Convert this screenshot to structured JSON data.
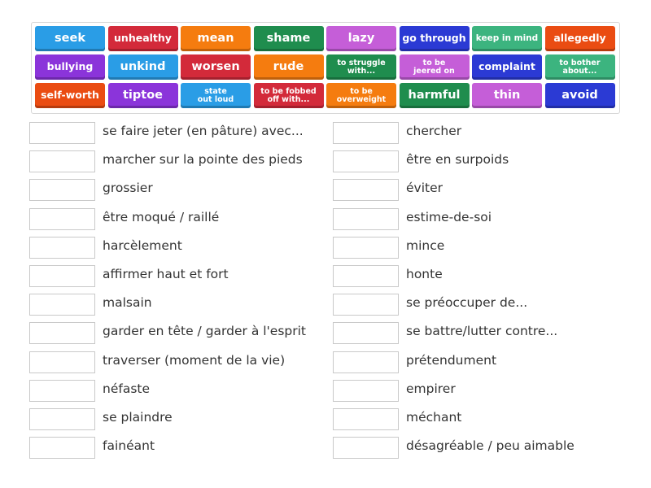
{
  "colors": {
    "blue": "#2a9de6",
    "red": "#d32a3a",
    "orange": "#f57c0f",
    "green": "#1f8d4e",
    "purple": "#8b34da",
    "pink": "#c55ed8",
    "navy": "#2b3ad4",
    "mint": "#3cb47f",
    "redorange": "#ea4c12"
  },
  "tiles": [
    {
      "label": "seek",
      "color": "blue",
      "size": "lg"
    },
    {
      "label": "unhealthy",
      "color": "red",
      "size": "md"
    },
    {
      "label": "mean",
      "color": "orange",
      "size": "lg"
    },
    {
      "label": "shame",
      "color": "green",
      "size": "lg"
    },
    {
      "label": "lazy",
      "color": "pink",
      "size": "lg"
    },
    {
      "label": "go through",
      "color": "navy",
      "size": "md"
    },
    {
      "label": "keep in mind",
      "color": "mint",
      "size": "sm"
    },
    {
      "label": "allegedly",
      "color": "redorange",
      "size": "md"
    },
    {
      "label": "bullying",
      "color": "purple",
      "size": "md"
    },
    {
      "label": "unkind",
      "color": "blue",
      "size": "lg"
    },
    {
      "label": "worsen",
      "color": "red",
      "size": "lg"
    },
    {
      "label": "rude",
      "color": "orange",
      "size": "lg"
    },
    {
      "label": "to struggle with...",
      "color": "green",
      "size": "xs",
      "lines": [
        "to struggle",
        "with..."
      ]
    },
    {
      "label": "to be jeered on",
      "color": "pink",
      "size": "xs",
      "lines": [
        "to be",
        "jeered on"
      ]
    },
    {
      "label": "complaint",
      "color": "navy",
      "size": "md"
    },
    {
      "label": "to bother about...",
      "color": "mint",
      "size": "xs",
      "lines": [
        "to bother",
        "about..."
      ]
    },
    {
      "label": "self-worth",
      "color": "redorange",
      "size": "md"
    },
    {
      "label": "tiptoe",
      "color": "purple",
      "size": "lg"
    },
    {
      "label": "state out loud",
      "color": "blue",
      "size": "xs",
      "lines": [
        "state",
        "out loud"
      ]
    },
    {
      "label": "to be fobbed off with...",
      "color": "red",
      "size": "xs",
      "lines": [
        "to be fobbed",
        "off with..."
      ]
    },
    {
      "label": "to be overweight",
      "color": "orange",
      "size": "xs",
      "lines": [
        "to be",
        "overweight"
      ]
    },
    {
      "label": "harmful",
      "color": "green",
      "size": "lg"
    },
    {
      "label": "thin",
      "color": "pink",
      "size": "lg"
    },
    {
      "label": "avoid",
      "color": "navy",
      "size": "lg"
    }
  ],
  "left_prompts": [
    "se faire jeter (en pâture) avec...",
    "marcher sur la pointe des pieds",
    "grossier",
    "être moqué / raillé",
    "harcèlement",
    "affirmer haut et fort",
    "malsain",
    "garder en tête / garder à l'esprit",
    "traverser (moment de la vie)",
    "néfaste",
    "se plaindre",
    "fainéant"
  ],
  "right_prompts": [
    "chercher",
    "être en surpoids",
    "éviter",
    "estime-de-soi",
    "mince",
    "honte",
    "se préoccuper de...",
    "se battre/lutter contre...",
    "prétendument",
    "empirer",
    "méchant",
    "désagréable / peu aimable"
  ]
}
